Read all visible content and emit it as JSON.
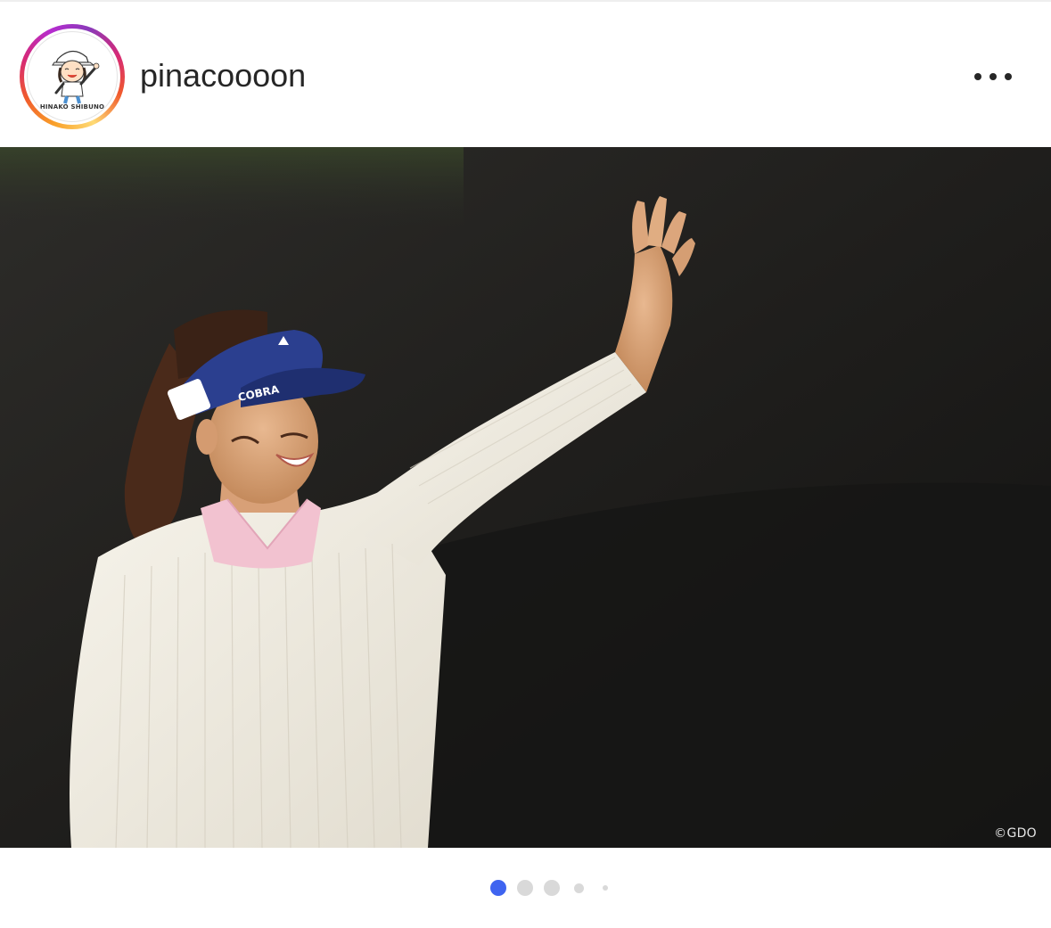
{
  "post": {
    "username": "pinacoooon",
    "avatar": {
      "caption": "HINAKO SHIBUNO",
      "ring_colors": [
        "#feda75",
        "#f05a2c",
        "#d62976",
        "#8a3ab9"
      ]
    },
    "more_icon": "more-horizontal-icon",
    "photo": {
      "watermark": "©GDO",
      "visor_text": "COBRA"
    },
    "carousel": {
      "total_dots": 5,
      "active_index": 0,
      "active_color": "#3f64f0",
      "inactive_color": "#d9d9d9"
    }
  }
}
